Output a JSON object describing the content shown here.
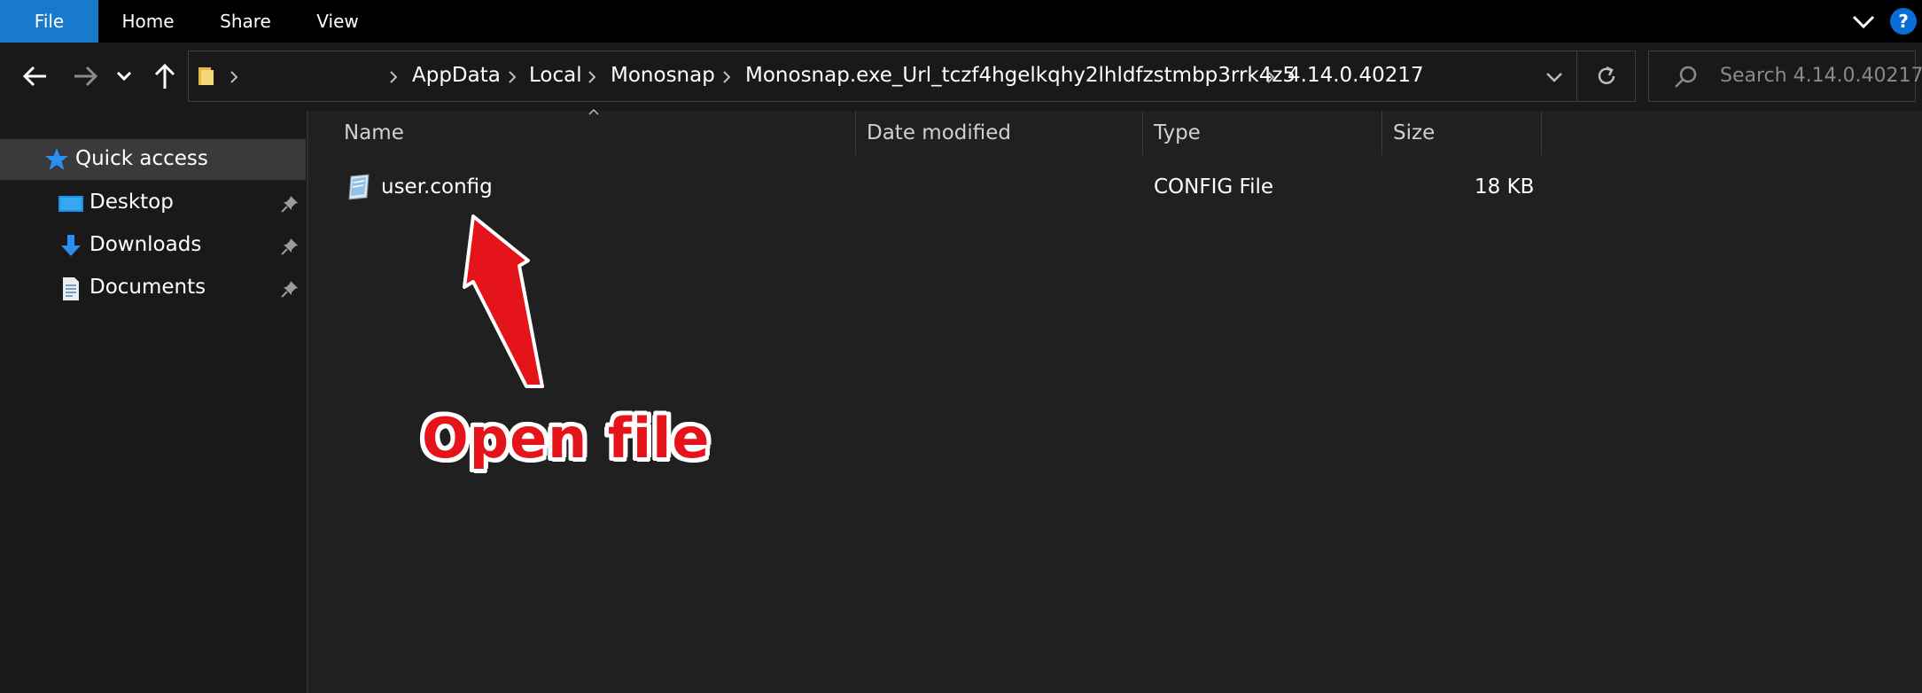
{
  "ribbon": {
    "tabs": [
      "File",
      "Home",
      "Share",
      "View"
    ],
    "help_label": "?"
  },
  "address_bar": {
    "breadcrumbs": [
      "AppData",
      "Local",
      "Monosnap",
      "Monosnap.exe_Url_tczf4hgelkqhy2lhldfzstmbp3rrk4z5",
      "4.14.0.40217"
    ]
  },
  "search": {
    "placeholder": "Search 4.14.0.40217"
  },
  "sidebar": {
    "quick_access_label": "Quick access",
    "items": [
      {
        "label": "Desktop",
        "icon": "desktop-icon"
      },
      {
        "label": "Downloads",
        "icon": "downloads-icon"
      },
      {
        "label": "Documents",
        "icon": "documents-icon"
      }
    ]
  },
  "columns": {
    "name": "Name",
    "date_modified": "Date modified",
    "type": "Type",
    "size": "Size"
  },
  "files": [
    {
      "name": "user.config",
      "date_modified": "",
      "type": "CONFIG File",
      "size": "18 KB"
    }
  ],
  "annotation": {
    "text": "Open file",
    "color": "#e5141b"
  },
  "colors": {
    "file_tab": "#1979ca",
    "help": "#0a6cd6",
    "background": "#202020"
  }
}
